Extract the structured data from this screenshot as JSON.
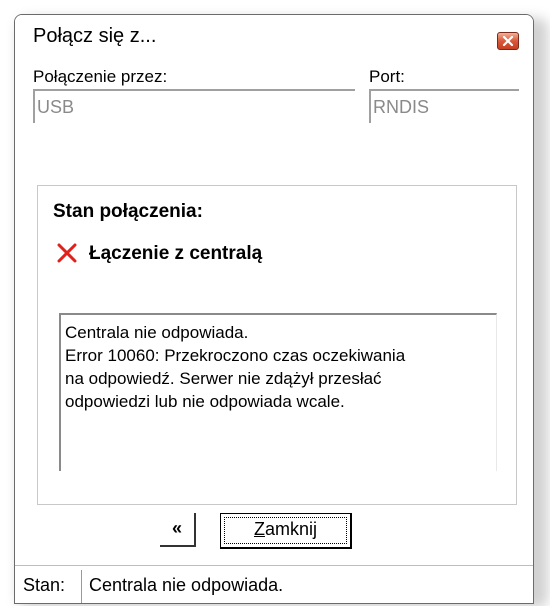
{
  "window": {
    "title": "Połącz się z..."
  },
  "connection": {
    "via_label": "Połączenie przez:",
    "via_value": "USB",
    "port_label": "Port:",
    "port_value": "RNDIS"
  },
  "status": {
    "heading": "Stan połączenia:",
    "step_label": "Łączenie z centralą",
    "step_icon": "error-x-icon",
    "message": "Centrala nie odpowiada.\nError 10060: Przekroczono czas oczekiwania\nna odpowiedź. Serwer nie zdążył przesłać\nodpowiedzi lub nie odpowiada wcale."
  },
  "buttons": {
    "back_label": "«",
    "close_label_prefix": "",
    "close_label_underlined": "Z",
    "close_label_rest": "amknij"
  },
  "statusbar": {
    "label": "Stan:",
    "text": "Centrala nie odpowiada."
  },
  "colors": {
    "error": "#e0201a",
    "close_button_red": "#d9583a"
  }
}
